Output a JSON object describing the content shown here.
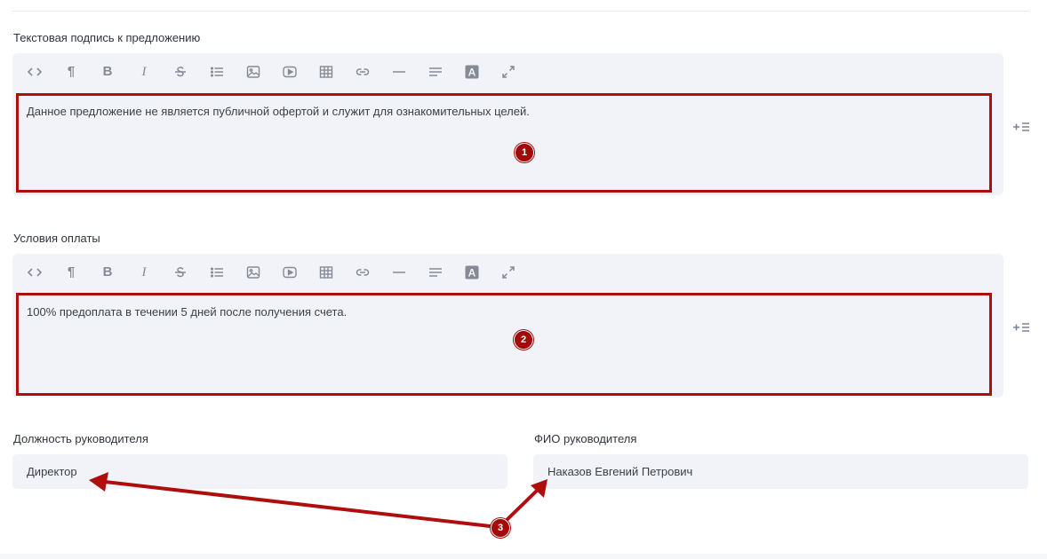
{
  "sections": [
    {
      "label": "Текстовая подпись к предложению",
      "content": "Данное предложение не является публичной офертой и служит для ознакомительных целей.",
      "marker": "1"
    },
    {
      "label": "Условия оплаты",
      "content": "100% предоплата в течении 5 дней после получения счета.",
      "marker": "2"
    }
  ],
  "toolbar": {
    "buttons": [
      "html-code",
      "paragraph",
      "bold",
      "italic",
      "strikethrough",
      "list",
      "image",
      "video",
      "table",
      "link",
      "horizontal-rule",
      "align",
      "text-color",
      "fullscreen"
    ],
    "bold_glyph": "B",
    "italic_glyph": "I",
    "paragraph_glyph": "¶",
    "text_color_glyph": "A"
  },
  "fields": {
    "position": {
      "label": "Должность руководителя",
      "value": "Директор"
    },
    "name": {
      "label": "ФИО руководителя",
      "value": "Наказов Евгений Петрович"
    }
  },
  "arrow_marker": "3",
  "colors": {
    "annotation": "#b00d0d",
    "field_bg": "#f2f3f8",
    "icon": "#868a96"
  }
}
